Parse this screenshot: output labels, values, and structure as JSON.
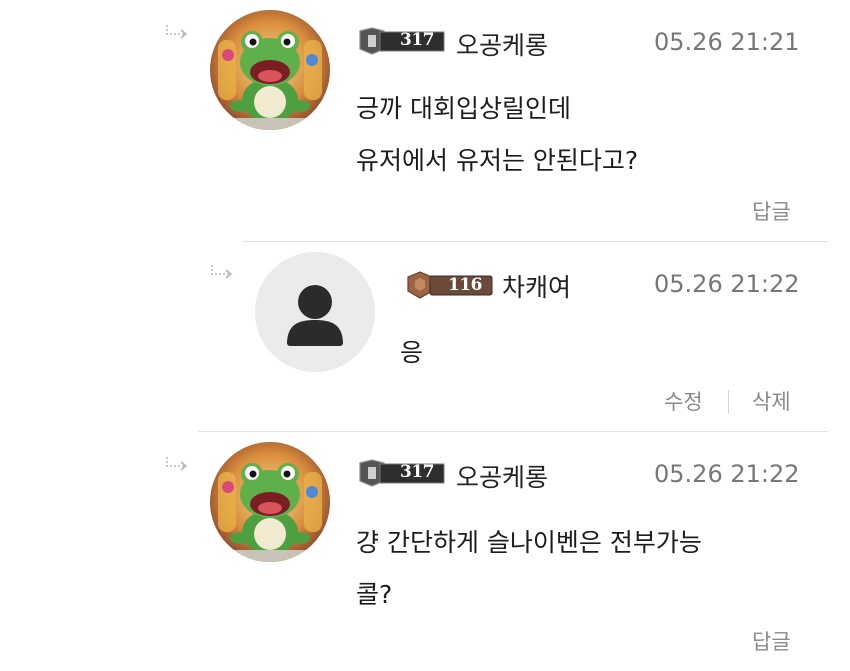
{
  "comments": [
    {
      "nickname": "오공케롱",
      "level": "317",
      "time": "05.26 21:21",
      "lines": [
        "긍까 대회입상릴인데",
        "유저에서 유저는 안된다고?"
      ],
      "action": "답글",
      "avatar": "frog-avatar"
    },
    {
      "nickname": "차캐여",
      "level": "116",
      "time": "05.26 21:22",
      "lines": [
        "응"
      ],
      "actions": [
        "수정",
        "삭제"
      ],
      "avatar": "default-user-avatar"
    },
    {
      "nickname": "오공케롱",
      "level": "317",
      "time": "05.26 21:22",
      "lines": [
        "걍 간단하게 슬나이벤은 전부가능",
        "콜?"
      ],
      "action": "답글",
      "avatar": "frog-avatar"
    }
  ],
  "icons": {
    "reply_arrow": "reply-arrow-icon",
    "default_avatar": "user-silhouette-icon"
  },
  "colors": {
    "badge_dark": "#3a3a3a",
    "badge_bronze": "#8a5a3c",
    "avatar_gray": "#ebebee",
    "frog_green": "#5fb04a"
  }
}
